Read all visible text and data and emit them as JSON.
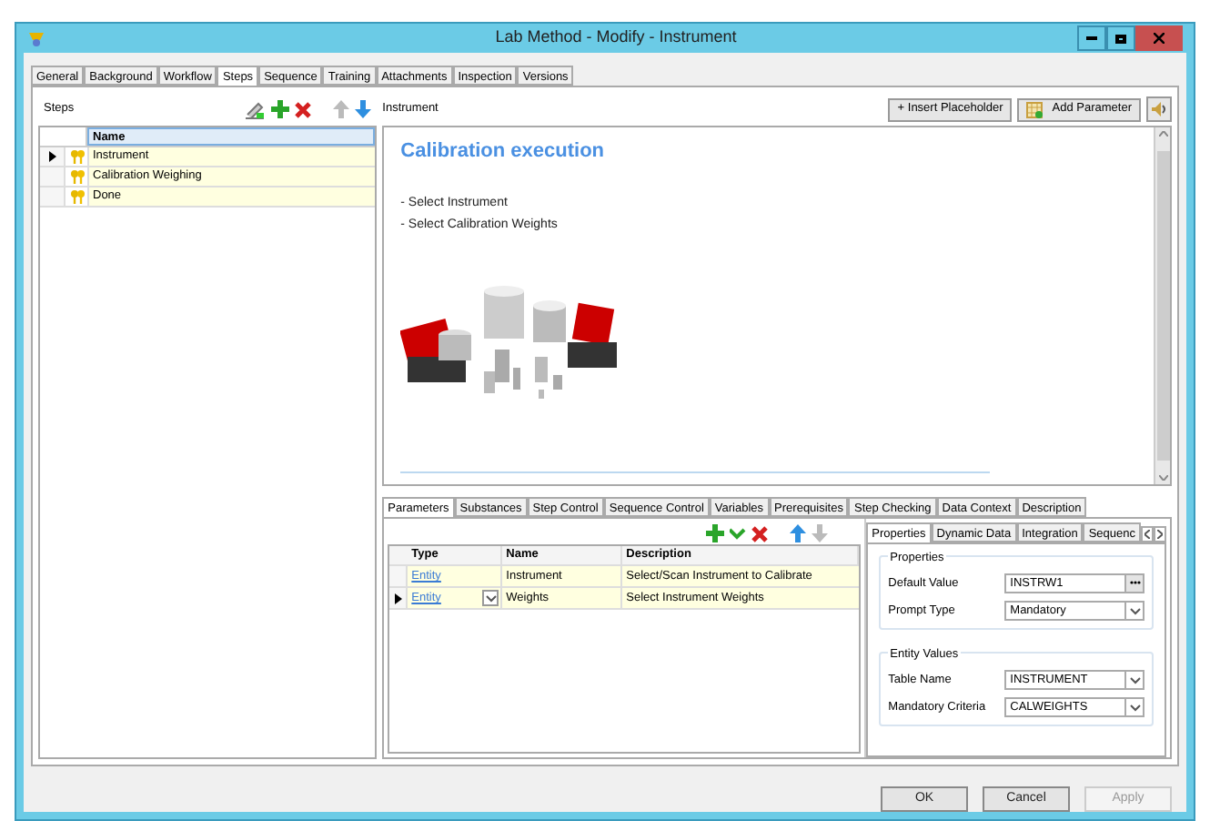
{
  "window": {
    "title": "Lab Method - Modify - Instrument"
  },
  "main_tabs": [
    {
      "label": "General",
      "selected": false
    },
    {
      "label": "Background",
      "selected": false
    },
    {
      "label": "Workflow",
      "selected": false
    },
    {
      "label": "Steps",
      "selected": true
    },
    {
      "label": "Sequence",
      "selected": false
    },
    {
      "label": "Training",
      "selected": false
    },
    {
      "label": "Attachments",
      "selected": false
    },
    {
      "label": "Inspection",
      "selected": false
    },
    {
      "label": "Versions",
      "selected": false
    }
  ],
  "steps": {
    "label": "Steps",
    "column": "Name",
    "rows": [
      {
        "name": "Instrument",
        "selected": true
      },
      {
        "name": "Calibration Weighing",
        "selected": false
      },
      {
        "name": "Done",
        "selected": false
      }
    ]
  },
  "editor": {
    "title": "Instrument",
    "buttons": [
      {
        "label": "+ Insert Placeholder",
        "kind": "text"
      },
      {
        "label": "Add Parameter",
        "kind": "grid"
      }
    ],
    "heading": "Calibration execution",
    "lines": [
      "- Select Instrument",
      "- Select Calibration Weights"
    ]
  },
  "bottom_tabs": [
    {
      "label": "Parameters",
      "selected": true
    },
    {
      "label": "Substances",
      "selected": false
    },
    {
      "label": "Step Control",
      "selected": false
    },
    {
      "label": "Sequence Control",
      "selected": false
    },
    {
      "label": "Variables",
      "selected": false
    },
    {
      "label": "Prerequisites",
      "selected": false
    },
    {
      "label": "Step Checking",
      "selected": false
    },
    {
      "label": "Data Context",
      "selected": false
    },
    {
      "label": "Description",
      "selected": false
    }
  ],
  "parameters": {
    "columns": [
      "Type",
      "Name",
      "Description"
    ],
    "rows": [
      {
        "type": "Entity",
        "name": "Instrument",
        "description": "Select/Scan Instrument to Calibrate",
        "selected": false
      },
      {
        "type": "Entity",
        "name": "Weights",
        "description": "Select Instrument Weights",
        "selected": true
      }
    ]
  },
  "property_tabs": [
    {
      "label": "Properties",
      "selected": true
    },
    {
      "label": "Dynamic Data",
      "selected": false
    },
    {
      "label": "Integration",
      "selected": false
    },
    {
      "label": "Sequenc",
      "selected": false
    }
  ],
  "groups": [
    {
      "title": "Properties",
      "fields": [
        {
          "label": "Default Value",
          "value": "INSTRW1",
          "kind": "browse"
        },
        {
          "label": "Prompt Type",
          "value": "Mandatory",
          "kind": "dropdown"
        }
      ]
    },
    {
      "title": "Entity Values",
      "fields": [
        {
          "label": "Table Name",
          "value": "INSTRUMENT",
          "kind": "dropdown"
        },
        {
          "label": "Mandatory Criteria",
          "value": "CALWEIGHTS",
          "kind": "dropdown"
        }
      ]
    }
  ],
  "dialog_buttons": [
    {
      "label": "OK",
      "disabled": false
    },
    {
      "label": "Cancel",
      "disabled": false
    },
    {
      "label": "Apply",
      "disabled": true
    }
  ]
}
